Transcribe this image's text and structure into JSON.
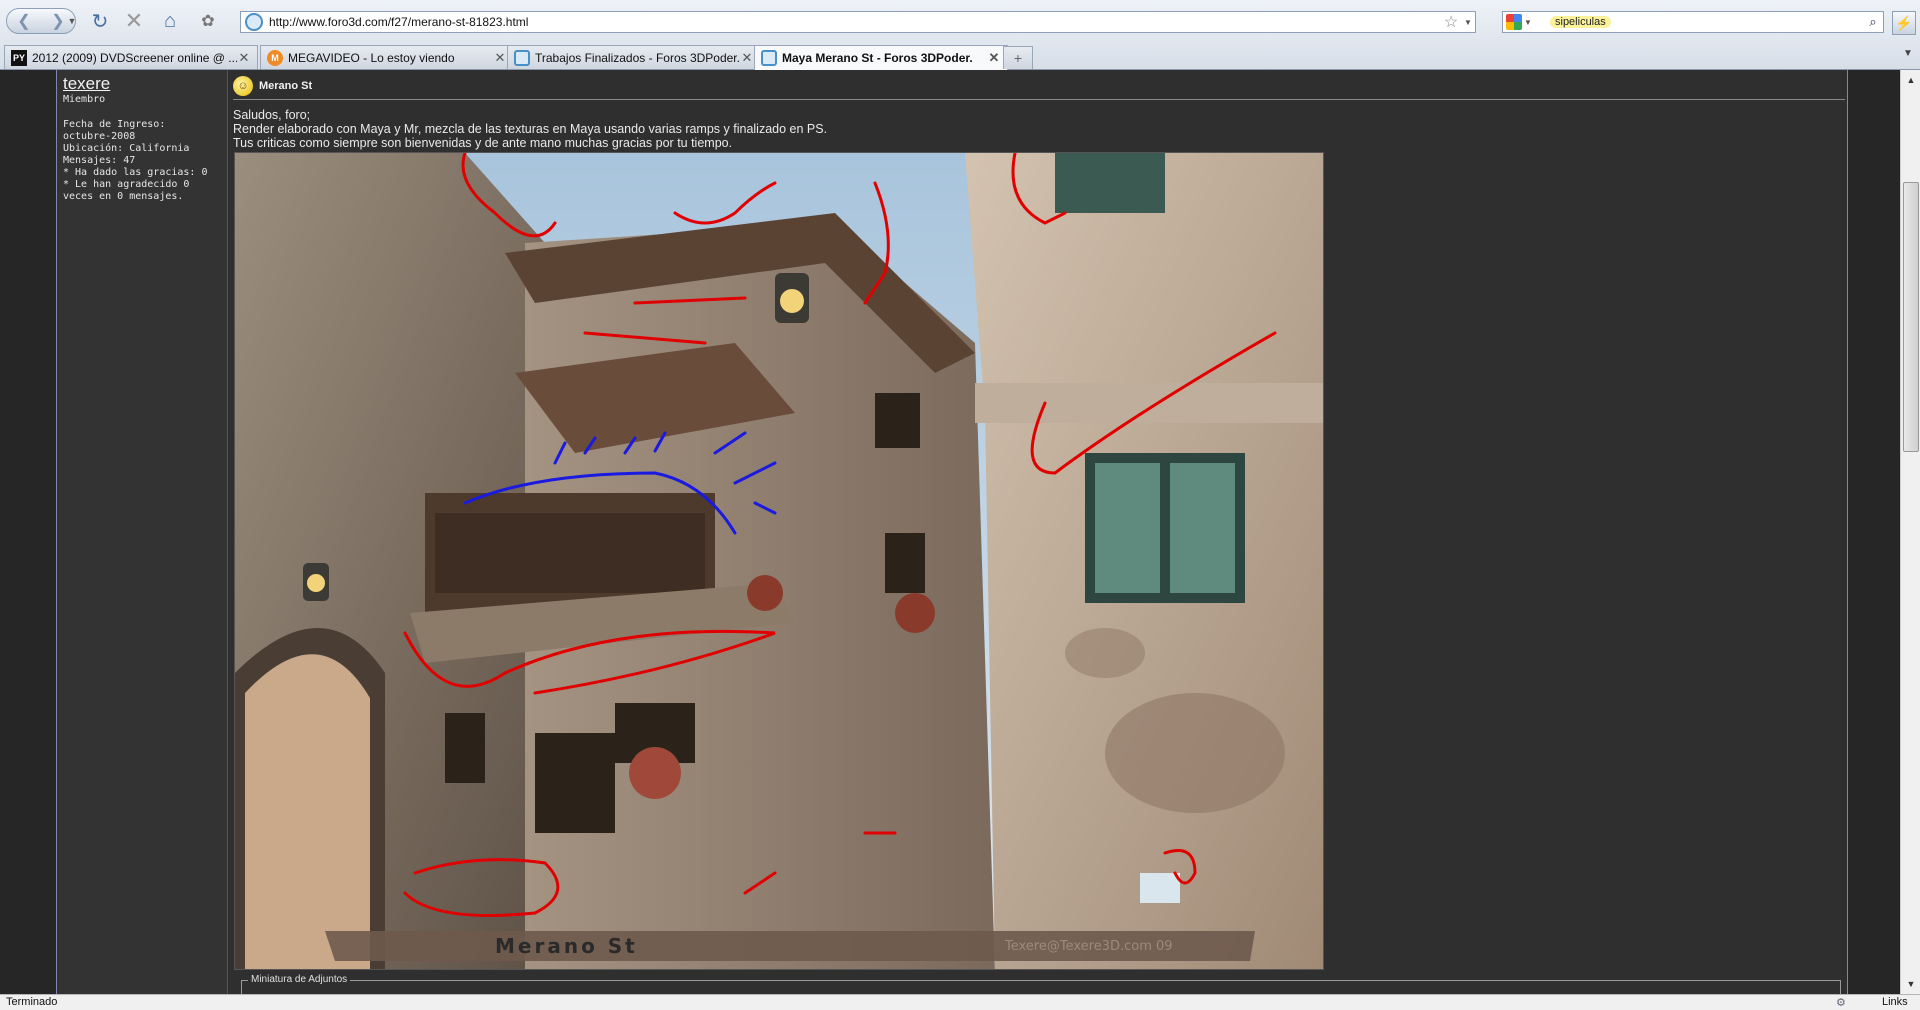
{
  "browser": {
    "url": "http://www.foro3d.com/f27/merano-st-81823.html",
    "search_query": "sipeliculas",
    "tabs": [
      {
        "label": "2012 (2009) DVDScreener online @ ...",
        "favicon": "PY",
        "active": false
      },
      {
        "label": "MEGAVIDEO - Lo estoy viendo",
        "favicon": "M",
        "active": false
      },
      {
        "label": "Trabajos Finalizados - Foros 3DPoder.",
        "favicon": "",
        "active": false
      },
      {
        "label": "Maya Merano St - Foros 3DPoder.",
        "favicon": "",
        "active": true
      }
    ],
    "new_tab": "+",
    "status": "Terminado",
    "status_links": "Links"
  },
  "user": {
    "name": "texere",
    "rank": "Miembro",
    "stats": [
      "Fecha de Ingreso:",
      "octubre-2008",
      "Ubicación: California",
      "Mensajes: 47",
      "* Ha dado las gracias: 0",
      "* Le han agradecido 0",
      "veces en 0 mensajes."
    ]
  },
  "post": {
    "title": "Merano St",
    "lines": [
      "Saludos, foro;",
      "Render elaborado con Maya y Mr, mezcla de las texturas en Maya usando varias ramps y finalizado en PS.",
      "Tus criticas como siempre son bienvenidas y de ante mano muchas gracias por tu tiempo."
    ],
    "render_caption": "Merano St",
    "render_credit": "Texere@Texere3D.com 09",
    "attachments_legend": "Miniatura de Adjuntos"
  },
  "colors": {
    "page_bg": "#2f2f2f",
    "frame_border": "#7d88b5",
    "annotation_red": "#e00000",
    "annotation_blue": "#1a1ae0"
  },
  "icons": [
    "back-icon",
    "forward-icon",
    "reload-icon",
    "stop-icon",
    "home-icon",
    "addon-icon",
    "star-icon",
    "google-icon",
    "search-icon",
    "close-icon"
  ]
}
